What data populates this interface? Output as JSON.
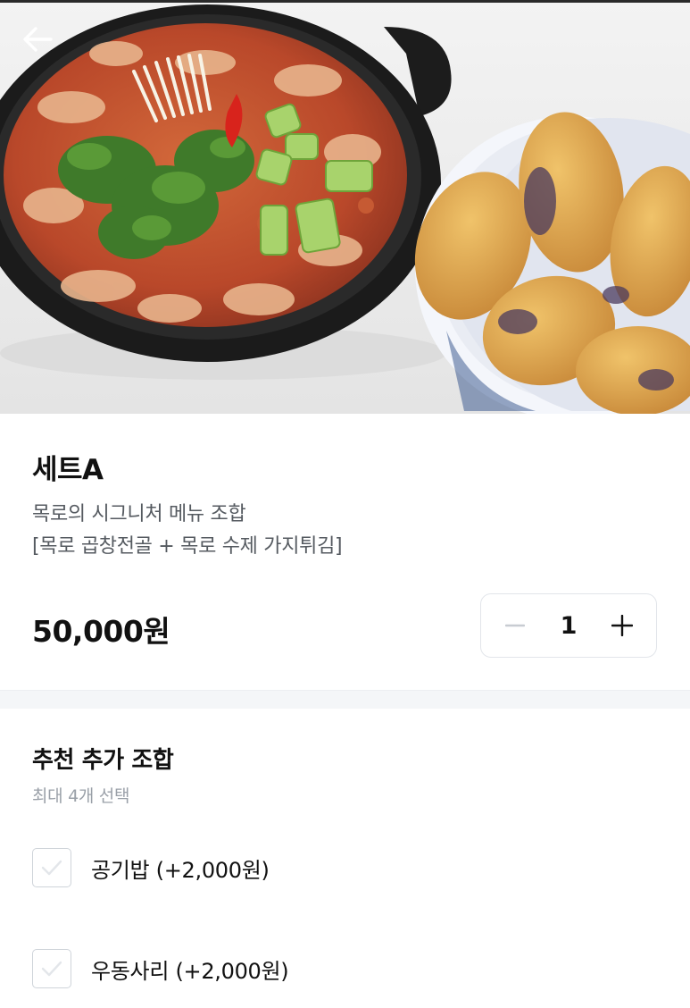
{
  "header": {
    "back_icon": "arrow-left-icon",
    "hero_image": "gopchang-jeongol-and-fried-eggplant-photo"
  },
  "product": {
    "name": "세트A",
    "description_line1": "목로의 시그니처 메뉴 조합",
    "description_line2": "[목로 곱창전골 + 목로 수제 가지튀김]",
    "price": "50,000원",
    "quantity": "1",
    "minus_icon": "minus-icon",
    "plus_icon": "plus-icon"
  },
  "options": {
    "title": "추천 추가 조합",
    "subtitle": "최대 4개 선택",
    "items": [
      {
        "label": "공기밥 (+2,000원)",
        "checked": false,
        "icon": "check-icon"
      },
      {
        "label": "우동사리 (+2,000원)",
        "checked": false,
        "icon": "check-icon"
      }
    ]
  },
  "colors": {
    "text_primary": "#111111",
    "text_secondary": "#555a60",
    "text_muted": "#9aa0a8",
    "border": "#e2e5ea",
    "divider_band": "#f4f6f8"
  }
}
